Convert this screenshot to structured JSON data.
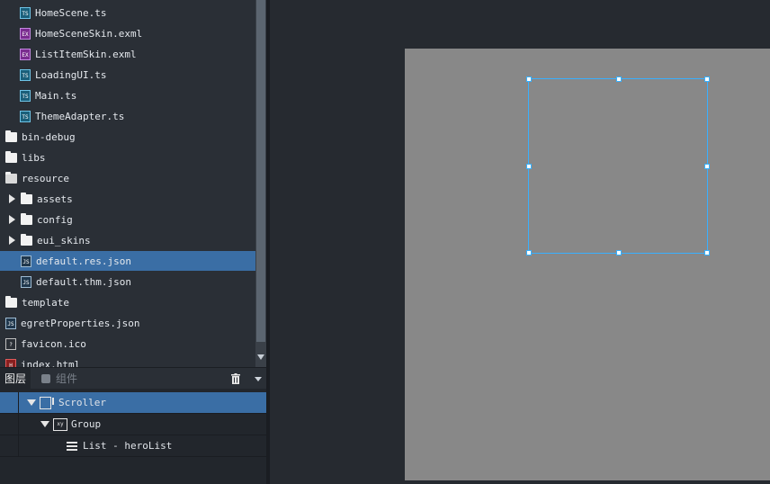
{
  "file_tree": [
    {
      "label": "HomeScene.ts",
      "type": "ts",
      "indent": 1
    },
    {
      "label": "HomeSceneSkin.exml",
      "type": "exml",
      "indent": 1
    },
    {
      "label": "ListItemSkin.exml",
      "type": "exml",
      "indent": 1
    },
    {
      "label": "LoadingUI.ts",
      "type": "ts",
      "indent": 1
    },
    {
      "label": "Main.ts",
      "type": "ts",
      "indent": 1
    },
    {
      "label": "ThemeAdapter.ts",
      "type": "ts",
      "indent": 1
    },
    {
      "label": "bin-debug",
      "type": "folder",
      "indent": 0
    },
    {
      "label": "libs",
      "type": "folder",
      "indent": 0
    },
    {
      "label": "resource",
      "type": "folder-open",
      "indent": 0
    },
    {
      "label": "assets",
      "type": "folder-collapsed",
      "indent": 1
    },
    {
      "label": "config",
      "type": "folder-collapsed",
      "indent": 1
    },
    {
      "label": "eui_skins",
      "type": "folder-collapsed",
      "indent": 1
    },
    {
      "label": "default.res.json",
      "type": "json",
      "indent": 1,
      "selected": true
    },
    {
      "label": "default.thm.json",
      "type": "json",
      "indent": 1
    },
    {
      "label": "template",
      "type": "folder",
      "indent": 0
    },
    {
      "label": "egretProperties.json",
      "type": "json",
      "indent": 0
    },
    {
      "label": "favicon.ico",
      "type": "ico",
      "indent": 0
    },
    {
      "label": "index.html",
      "type": "html",
      "indent": 0
    }
  ],
  "layers_panel": {
    "tab_layers": "图层",
    "tab_components": "组件",
    "items": [
      {
        "label": "Scroller",
        "icon": "scroller-icon",
        "selected": true
      },
      {
        "label": "Group",
        "icon": "group-icon"
      },
      {
        "label": "List - heroList",
        "icon": "list-icon"
      }
    ]
  },
  "colors": {
    "selection": "#3a6ea5",
    "artboard": "#888888",
    "handle_border": "#39b0ff"
  }
}
